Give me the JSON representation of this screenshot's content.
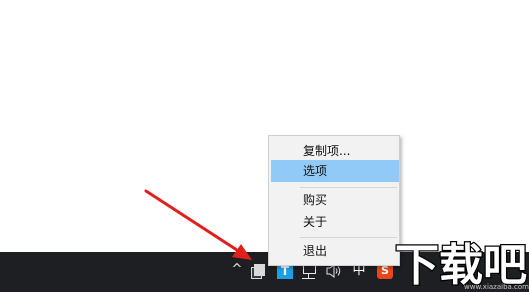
{
  "context_menu": {
    "items": [
      {
        "label": "复制项..."
      },
      {
        "label": "选项"
      },
      {
        "label": "购买"
      },
      {
        "label": "关于"
      },
      {
        "label": "退出"
      }
    ]
  },
  "tray": {
    "overflow_glyph": "^",
    "app_label": "T",
    "ime_label": "中",
    "sogou_label": "S"
  },
  "watermark": {
    "logo_text": "下载吧",
    "url": "www.xiazaiba.com"
  },
  "colors": {
    "taskbar": "#1e1f22",
    "menu_bg": "#f2f2f2",
    "menu_highlight": "#91c9f7",
    "arrow": "#e0201c",
    "app_icon": "#1aa0e6",
    "sogou_icon": "#e8471e"
  }
}
